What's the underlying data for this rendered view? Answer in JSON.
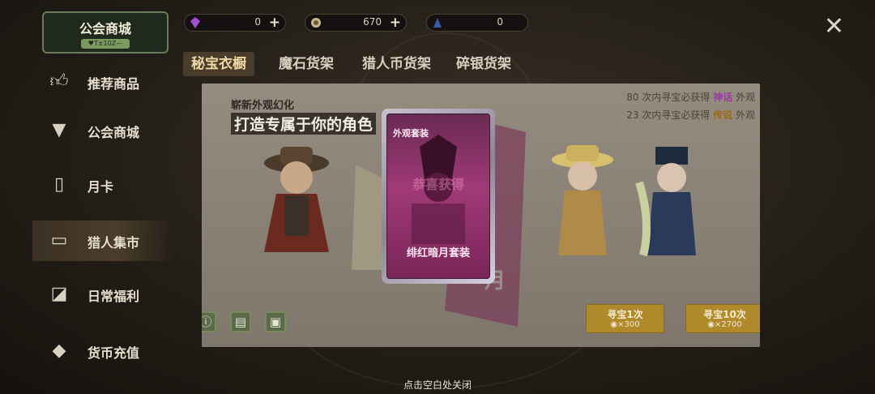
{
  "header": {
    "shop_title": "公会商城",
    "shop_subtitle": "♥T±10Z—"
  },
  "currencies": [
    {
      "icon": "purple-gem-icon",
      "value": "0",
      "has_add": true
    },
    {
      "icon": "gold-coin-icon",
      "value": "670",
      "has_add": true
    },
    {
      "icon": "hunter-coin-icon",
      "value": "0",
      "has_add": false
    }
  ],
  "tabs": [
    {
      "label": "秘宝衣橱",
      "active": true
    },
    {
      "label": "魔石货架",
      "active": false
    },
    {
      "label": "猎人币货架",
      "active": false
    },
    {
      "label": "碎银货架",
      "active": false
    }
  ],
  "sidebar": [
    {
      "label": "推荐商品",
      "icon": "thumbs-up-icon",
      "active": false
    },
    {
      "label": "公会商城",
      "icon": "fox-icon",
      "active": false
    },
    {
      "label": "月卡",
      "icon": "card-icon",
      "active": false
    },
    {
      "label": "猎人集市",
      "icon": "stall-icon",
      "active": true
    },
    {
      "label": "日常福利",
      "icon": "gift-icon",
      "active": false
    },
    {
      "label": "货币充值",
      "icon": "diamond-icon",
      "active": false
    }
  ],
  "banner": {
    "subtitle": "崭新外观幻化",
    "title": "打造专属于你的角色",
    "guarantee_1": {
      "count": "80",
      "text": "次内寻宝必获得",
      "rarity": "神话",
      "suffix": "外观"
    },
    "guarantee_2": {
      "count": "23",
      "text": "次内寻宝必获得",
      "rarity": "传说",
      "suffix": "外观"
    },
    "moon_text": "月"
  },
  "card": {
    "header": "外观套装",
    "watermark": "恭喜获得",
    "name": "绯红暗月套装"
  },
  "buttons": {
    "draw_1": {
      "label": "寻宝1次",
      "cost": "×300"
    },
    "draw_10": {
      "label": "寻宝10次",
      "cost": "×2700"
    }
  },
  "tools": [
    {
      "icon": "info-icon",
      "glyph": "ⓘ"
    },
    {
      "icon": "record-icon",
      "glyph": "▤"
    },
    {
      "icon": "image-icon",
      "glyph": "▣"
    }
  ],
  "footer_hint": "点击空白处关闭",
  "colors": {
    "accent_gold": "#b08a2a",
    "mythic": "#b040b0",
    "legend": "#b07820",
    "card_pink": "#a03a78"
  }
}
